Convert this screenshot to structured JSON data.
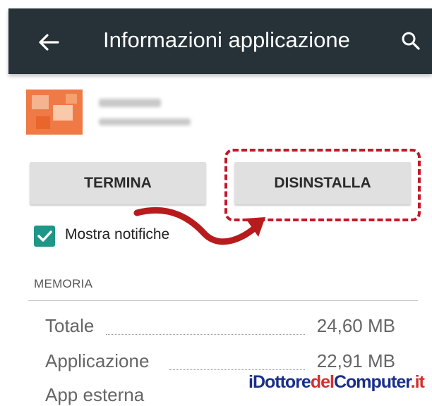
{
  "appbar": {
    "title": "Informazioni applicazione",
    "back_icon": "arrow-left-icon",
    "search_icon": "search-icon",
    "background_color": "#263238"
  },
  "app_header": {
    "icon": "app-icon",
    "icon_color": "#ef7a45",
    "name_obscured": true
  },
  "buttons": {
    "termina_label": "TERMINA",
    "disinstalla_label": "DISINSTALLA"
  },
  "annotation": {
    "highlight_color": "#c4182a",
    "arrow_icon": "curved-arrow-icon"
  },
  "notifications": {
    "checkbox_label": "Mostra notifiche",
    "checked": true,
    "checkbox_color": "#1e9688"
  },
  "memory": {
    "header": "MEMORIA",
    "rows": [
      {
        "label": "Totale",
        "value": "24,60 MB"
      },
      {
        "label": "Applicazione",
        "value": "22,91 MB"
      },
      {
        "label": "App esterna",
        "value": ""
      }
    ]
  },
  "watermark": {
    "part1": "iDottore",
    "part2": "del",
    "part3": "Computer",
    "part4": ".it"
  }
}
